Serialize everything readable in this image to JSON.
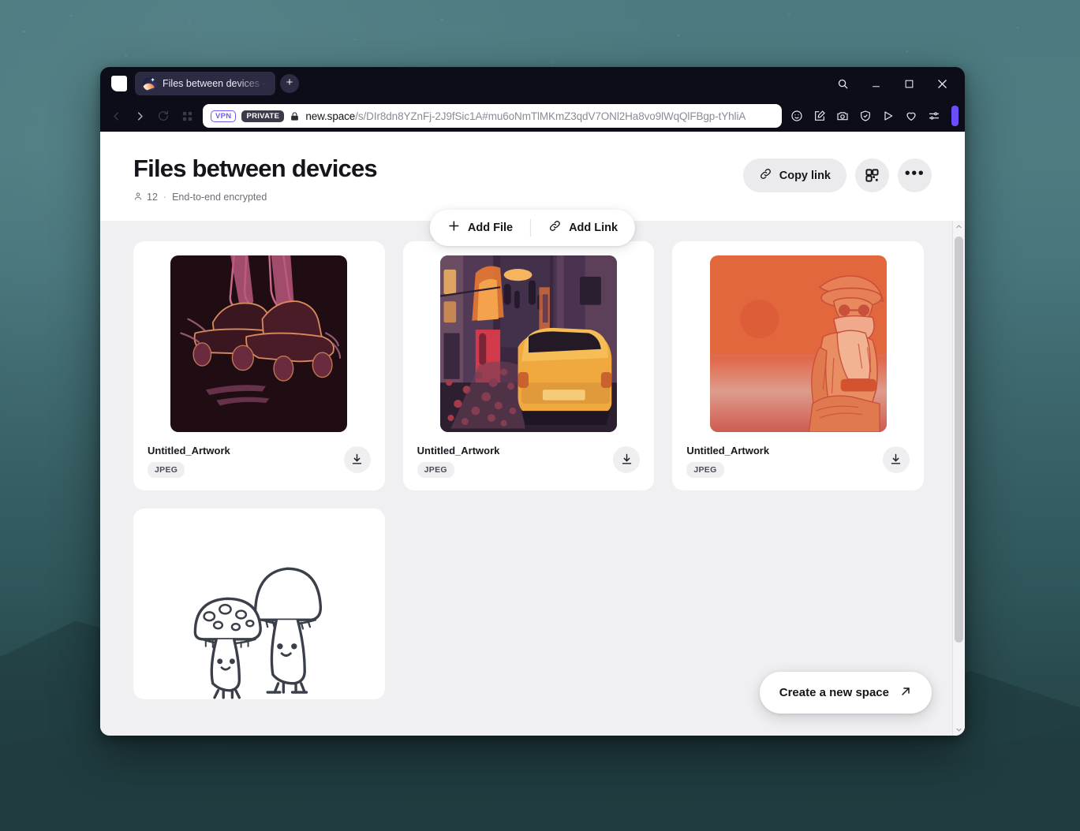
{
  "browser": {
    "tab": {
      "title": "Files between devices – ne",
      "favicon": "space-logo-icon"
    },
    "new_tab_label": "+",
    "window_controls": [
      "search-icon",
      "minimize-icon",
      "maximize-icon",
      "close-icon"
    ],
    "address": {
      "vpn_badge": "VPN",
      "private_badge": "PRIVATE",
      "lock": "lock-icon",
      "host": "new.space",
      "path": "/s/DIr8dn8YZnFj-2J9fSic1A#mu6oNmTlMKmZ3qdV7ONl2Ha8vo9lWqQlFBgp-tYhliA",
      "url_full": "new.space/s/DIr8dn8YZnFj-2J9fSic1A#mu6oNmTlMKmZ3qdV7ONl2Ha8vo9lWqQlFBgp-tYhliA"
    },
    "toolbar_icons": [
      "smiley-icon",
      "note-edit-icon",
      "camera-icon",
      "shield-check-icon",
      "send-icon",
      "heart-icon",
      "sliders-icon"
    ],
    "accent_color": "#6b4dfb"
  },
  "page": {
    "title": "Files between devices",
    "member_count": "12",
    "separator": "·",
    "encryption_status": "End-to-end encrypted",
    "actions": {
      "copy_link_label": "Copy link",
      "qr_label": "qr-code-icon",
      "more_label": "•••"
    },
    "add_bar": {
      "add_file_label": "Add File",
      "add_link_label": "Add Link"
    },
    "create_space_label": "Create a new space",
    "files": [
      {
        "name": "Untitled_Artwork",
        "type": "JPEG",
        "thumbnail": "roller-skates-dark-pink-illustration"
      },
      {
        "name": "Untitled_Artwork",
        "type": "JPEG",
        "thumbnail": "yellow-car-night-alley-illustration"
      },
      {
        "name": "Untitled_Artwork",
        "type": "JPEG",
        "thumbnail": "orange-desert-figure-illustration"
      },
      {
        "name": "",
        "type": "",
        "thumbnail": "two-cartoon-mushrooms-line-art"
      }
    ]
  }
}
